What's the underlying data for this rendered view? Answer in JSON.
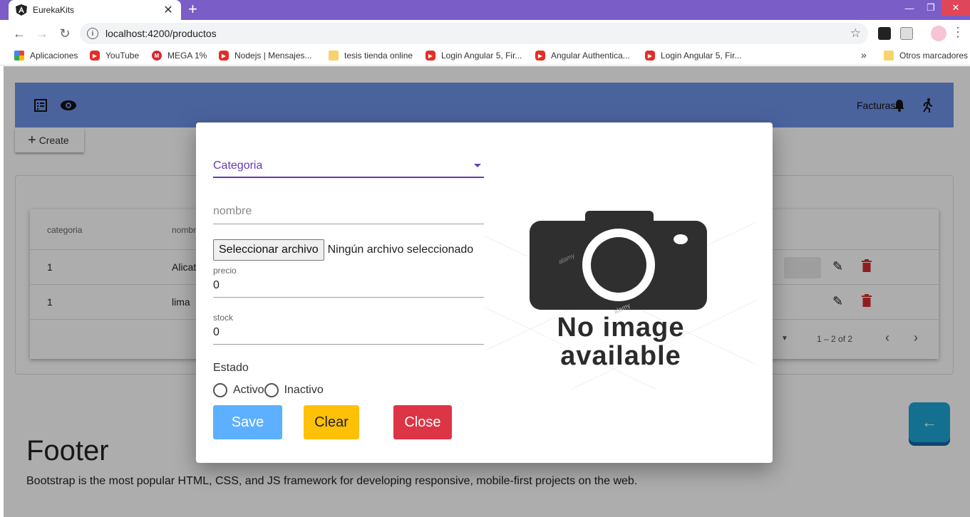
{
  "browser": {
    "tab_title": "EurekaKits",
    "url": "localhost:4200/productos",
    "bookmarks": [
      {
        "label": "Aplicaciones",
        "icon": "apps-icon"
      },
      {
        "label": "YouTube",
        "icon": "youtube-icon"
      },
      {
        "label": "MEGA 1%",
        "icon": "mega-icon"
      },
      {
        "label": "Nodejs | Mensajes...",
        "icon": "youtube-icon"
      },
      {
        "label": "tesis tienda online",
        "icon": "folder-icon"
      },
      {
        "label": "Login Angular 5, Fir...",
        "icon": "youtube-icon"
      },
      {
        "label": "Angular Authentica...",
        "icon": "youtube-icon"
      },
      {
        "label": "Login Angular 5, Fir...",
        "icon": "youtube-icon"
      }
    ],
    "bookmarks_overflow": "»",
    "other_bookmarks": "Otros marcadores"
  },
  "app": {
    "header": {
      "facturas": "Facturas"
    },
    "create_label": "Create",
    "table": {
      "columns": [
        "categoria",
        "nombre"
      ],
      "rows": [
        {
          "categoria": "1",
          "nombre": "Alicat"
        },
        {
          "categoria": "1",
          "nombre": "lima"
        }
      ],
      "range": "1 – 2 of 2"
    },
    "footer": {
      "title": "Footer",
      "text": "Bootstrap is the most popular HTML, CSS, and JS framework for developing responsive, mobile-first projects on the web."
    }
  },
  "dialog": {
    "categoria_label": "Categoria",
    "nombre_placeholder": "nombre",
    "file_button": "Seleccionar archivo",
    "file_status": "Ningún archivo seleccionado",
    "precio_label": "precio",
    "precio_value": "0",
    "stock_label": "stock",
    "stock_value": "0",
    "estado_label": "Estado",
    "radio_activo": "Activo",
    "radio_inactivo": "Inactivo",
    "save": "Save",
    "clear": "Clear",
    "close": "Close",
    "image_text_line1": "No image",
    "image_text_line2": "available",
    "watermark": "alamy"
  },
  "colors": {
    "chrome_purple": "#7a5dc7",
    "header_blue": "#6f93e8",
    "accent_purple": "#673ab7",
    "save_blue": "#5cb0ff",
    "clear_yellow": "#ffc107",
    "close_red": "#dc3545",
    "fab_blue": "#1ea5d6"
  }
}
